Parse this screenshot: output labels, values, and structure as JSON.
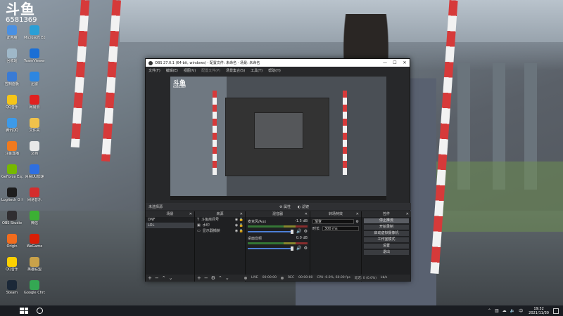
{
  "wallpaper": {
    "brand": "斗鱼",
    "room_number": "6581369"
  },
  "desktop_icons": [
    {
      "label": "此电脑",
      "icon": "computer-icon",
      "color": "#4a90e2"
    },
    {
      "label": "Microsoft Edge",
      "icon": "edge-icon",
      "color": "#2a9fd6"
    },
    {
      "label": "回收站",
      "icon": "recycle-bin-icon",
      "color": "#9fb8c9"
    },
    {
      "label": "TeamViewer",
      "icon": "teamviewer-icon",
      "color": "#1b6fd6"
    },
    {
      "label": "控制面板",
      "icon": "control-panel-icon",
      "color": "#3a7bd5"
    },
    {
      "label": "迅雷",
      "icon": "thunder-icon",
      "color": "#2d86e0"
    },
    {
      "label": "QQ音乐",
      "icon": "music-icon",
      "color": "#f5c518"
    },
    {
      "label": "网易云",
      "icon": "netease-icon",
      "color": "#e02020"
    },
    {
      "label": "腾讯QQ",
      "icon": "qq-icon",
      "color": "#3d9ae8"
    },
    {
      "label": "文件夹",
      "icon": "folder-icon",
      "color": "#f0c24b"
    },
    {
      "label": "斗鱼直播",
      "icon": "douyu-icon",
      "color": "#f07a1e"
    },
    {
      "label": "文档",
      "icon": "document-icon",
      "color": "#e8e8e8"
    },
    {
      "label": "GeForce Experience",
      "icon": "nvidia-icon",
      "color": "#76b900"
    },
    {
      "label": "网易UU加速",
      "icon": "uu-icon",
      "color": "#2f6fe0"
    },
    {
      "label": "Logitech G HUB",
      "icon": "logitech-icon",
      "color": "#1d1d1d"
    },
    {
      "label": "网易音乐",
      "icon": "music2-icon",
      "color": "#d42d2d"
    },
    {
      "label": "OBS Studio",
      "icon": "obs-icon",
      "color": "#302e31"
    },
    {
      "label": "微信",
      "icon": "wechat-icon",
      "color": "#3cb034"
    },
    {
      "label": "Origin",
      "icon": "origin-icon",
      "color": "#f26c1d"
    },
    {
      "label": "WeGame",
      "icon": "wegame-icon",
      "color": "#d81e06"
    },
    {
      "label": "QQ音乐",
      "icon": "qqmusic-icon",
      "color": "#fcd000"
    },
    {
      "label": "英雄联盟",
      "icon": "lol-icon",
      "color": "#c9a24a"
    },
    {
      "label": "Steam",
      "icon": "steam-icon",
      "color": "#1b2838"
    },
    {
      "label": "Google Chrome",
      "icon": "chrome-icon",
      "color": "#34a853"
    }
  ],
  "obs": {
    "title": "OBS 27.0.1 (64-bit, windows) - 配置文件: 未命名 - 场景: 未命名",
    "menu": [
      "文件(F)",
      "编辑(E)",
      "视图(V)",
      "配置文件(P)",
      "场景集合(S)",
      "工具(T)",
      "帮助(H)"
    ],
    "no_source_label": "未选择源",
    "properties_label": "属性",
    "filters_label": "滤镜",
    "docks": {
      "scenes_title": "场景",
      "sources_title": "来源",
      "mixer_title": "混音器",
      "transitions_title": "转场特效",
      "controls_title": "控件"
    },
    "scenes": [
      "DNF",
      "LOL"
    ],
    "sources": [
      {
        "name": "斗鱼房间号",
        "icon": "text-icon"
      },
      {
        "name": "水印",
        "icon": "image-icon"
      },
      {
        "name": "显示器捕获",
        "icon": "monitor-icon"
      }
    ],
    "mixer": [
      {
        "name": "麦克风/Aux",
        "db": "-1.5 dB"
      },
      {
        "name": "桌面音频",
        "db": "0.0 dB"
      }
    ],
    "transition": {
      "type_label": "渐变",
      "duration_label": "时长",
      "duration_value": "300 ms"
    },
    "controls": [
      "停止推流",
      "开始录制",
      "启动虚拟摄像机",
      "工作室模式",
      "设置",
      "退出"
    ],
    "status": {
      "rec_time": "00:00:00",
      "live_time": "00:00:00",
      "cpu": "CPU: 0.0%, 60.00 fps",
      "dropped": "延迟: 0 (0.0%)",
      "kbps": "kb/s",
      "live_label": "LIVE",
      "rec_label": "REC"
    }
  },
  "taskbar": {
    "time": "19:32",
    "date": "2021/11/30"
  }
}
